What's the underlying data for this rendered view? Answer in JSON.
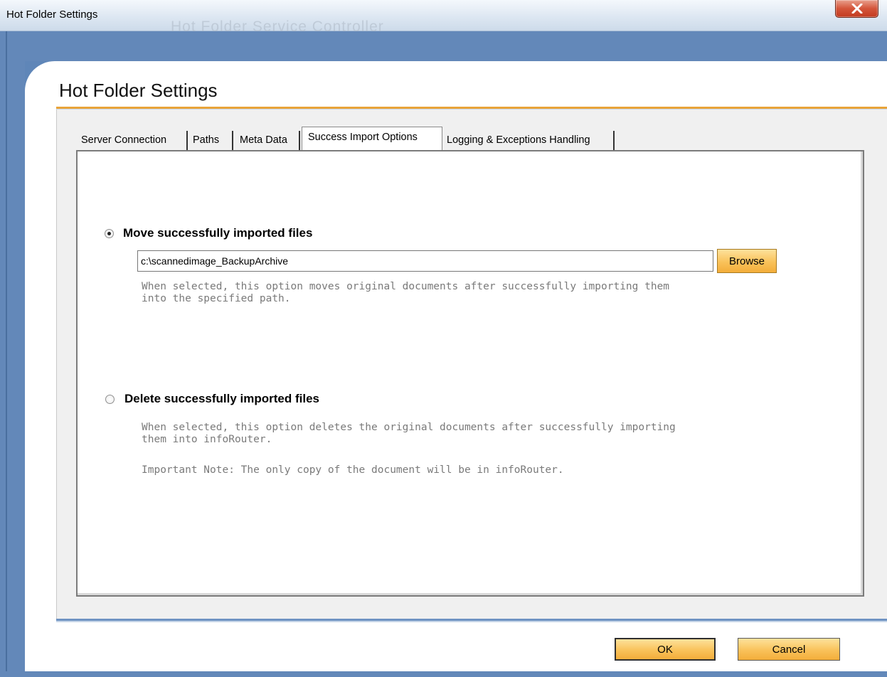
{
  "window": {
    "title": "Hot Folder Settings",
    "ghost_title": "Hot Folder Service Controller"
  },
  "page": {
    "heading": "Hot Folder Settings"
  },
  "tabs": [
    {
      "label": "Server Connection",
      "active": false
    },
    {
      "label": "Paths",
      "active": false
    },
    {
      "label": "Meta Data",
      "active": false
    },
    {
      "label": "Success Import Options",
      "active": true
    },
    {
      "label": "Logging & Exceptions Handling",
      "active": false
    }
  ],
  "options": {
    "move": {
      "label": "Move successfully imported files",
      "selected": true,
      "path_value": "c:\\scannedimage_BackupArchive",
      "browse_label": "Browse",
      "description_line1": "When selected, this option moves original documents after successfully importing them",
      "description_line2": "into the specified path."
    },
    "delete": {
      "label": "Delete successfully imported files",
      "selected": false,
      "description_line1": "When selected, this option deletes the original documents after successfully importing",
      "description_line2": "them into infoRouter.",
      "note": "Important Note: The only copy of the document will be in infoRouter."
    }
  },
  "buttons": {
    "ok": "OK",
    "cancel": "Cancel"
  },
  "colors": {
    "accent_orange": "#e9a43a",
    "frame_blue": "#6388b9",
    "button_gold": "#f9c25a"
  }
}
